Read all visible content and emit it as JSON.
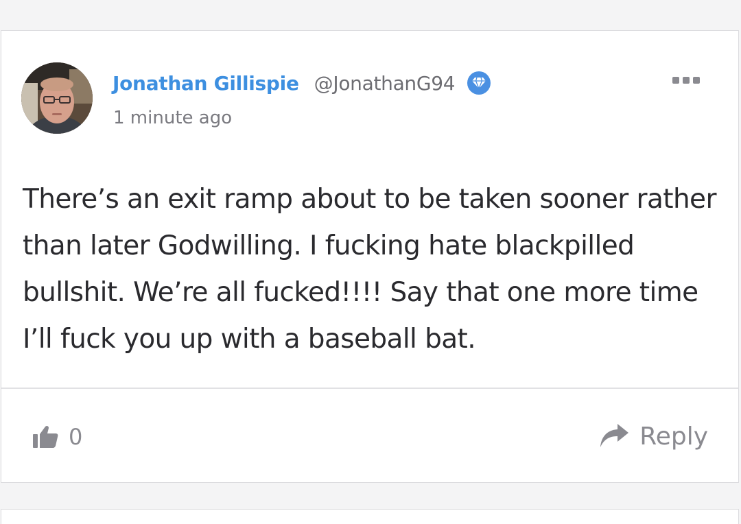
{
  "comment": {
    "author": {
      "display_name": "Jonathan Gillispie",
      "handle": "@JonathanG94",
      "badge_icon": "diamond-badge-icon"
    },
    "timestamp": "1 minute ago",
    "body": "There’s an exit ramp about to be taken sooner rather than later Godwilling. I fucking hate blackpilled bullshit. We’re all fucked!!!! Say that one more time I’ll fuck you up with a baseball bat.",
    "more_icon": "more-options-icon",
    "actions": {
      "like_icon": "thumbs-up-icon",
      "like_count": "0",
      "reply_icon": "reply-arrow-icon",
      "reply_label": "Reply"
    }
  },
  "colors": {
    "author_name": "#3d8fe0",
    "badge": "#4a90e2",
    "muted_text": "#8a8a90",
    "body_text": "#2a2a2e",
    "background": "#f4f4f5",
    "card": "#ffffff"
  }
}
